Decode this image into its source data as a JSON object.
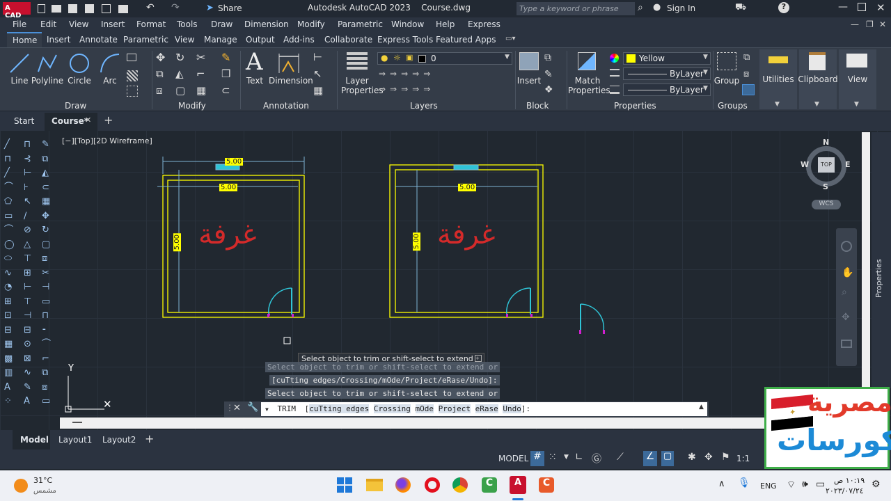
{
  "titlebar": {
    "logo": "A CAD",
    "share_label": "Share",
    "title": "Autodesk AutoCAD 2023    Course.dwg",
    "search_placeholder": "Type a keyword or phrase",
    "sign_in": "Sign In"
  },
  "menu": [
    "File",
    "Edit",
    "View",
    "Insert",
    "Format",
    "Tools",
    "Draw",
    "Dimension",
    "Modify",
    "Parametric",
    "Window",
    "Help",
    "Express"
  ],
  "ribbon_tabs": [
    "Home",
    "Insert",
    "Annotate",
    "Parametric",
    "View",
    "Manage",
    "Output",
    "Add-ins",
    "Collaborate",
    "Express Tools",
    "Featured Apps"
  ],
  "ribbon": {
    "draw": {
      "line": "Line",
      "polyline": "Polyline",
      "circle": "Circle",
      "arc": "Arc",
      "title": "Draw"
    },
    "modify_title": "Modify",
    "annotation": {
      "text": "Text",
      "dimension": "Dimension",
      "title": "Annotation"
    },
    "layers": {
      "layer_properties_1": "Layer",
      "layer_properties_2": "Properties",
      "current_layer": "0",
      "title": "Layers"
    },
    "block": {
      "insert": "Insert",
      "title": "Block"
    },
    "properties": {
      "match_1": "Match",
      "match_2": "Properties",
      "color": "Yellow",
      "linetype": "ByLayer",
      "lineweight": "ByLayer",
      "title": "Properties"
    },
    "groups": {
      "group": "Group",
      "title": "Groups"
    },
    "utilities": "Utilities",
    "clipboard": "Clipboard",
    "view": "View"
  },
  "file_tabs": {
    "start": "Start",
    "course": "Course*"
  },
  "viewport_label": "[−][Top][2D Wireframe]",
  "viewcube": {
    "n": "N",
    "s": "S",
    "e": "E",
    "w": "W",
    "top": "TOP",
    "wcs": "WCS"
  },
  "properties_palette": "Properties",
  "drawing": {
    "room_label": "غرفة",
    "dim_values": [
      "5.00",
      "5.00",
      "5.00",
      "5.00",
      "5.00"
    ]
  },
  "command": {
    "tooltip": "Select object to trim or shift-select to extend or",
    "history": [
      "Select object to trim or shift-select to extend or",
      "[cuTting edges/Crossing/mOde/Project/eRase/Undo]:",
      "Select object to trim or shift-select to extend or"
    ],
    "current_cmd": "TRIM",
    "options_open": "[",
    "options": [
      "cuTting edges",
      "Crossing",
      "mOde",
      "Project",
      "eRase",
      "Undo"
    ],
    "options_close": "]:"
  },
  "layouts": {
    "model": "Model",
    "layout1": "Layout1",
    "layout2": "Layout2"
  },
  "status": {
    "model": "MODEL",
    "scale": "1:1"
  },
  "taskbar": {
    "temp": "31°C",
    "weather": "مشمس",
    "lang": "ENG",
    "time": "١٠:١٩ ص",
    "date": "٢٠٢٣/٠٧/٢٤"
  },
  "watermark": {
    "line1": "مصرية",
    "line2": "كورسات"
  },
  "colors": {
    "accent": "#4a90d9",
    "yellow": "#ffff00",
    "cyan": "#2fc4d6",
    "red": "#d42a2a",
    "bg": "#212830"
  }
}
